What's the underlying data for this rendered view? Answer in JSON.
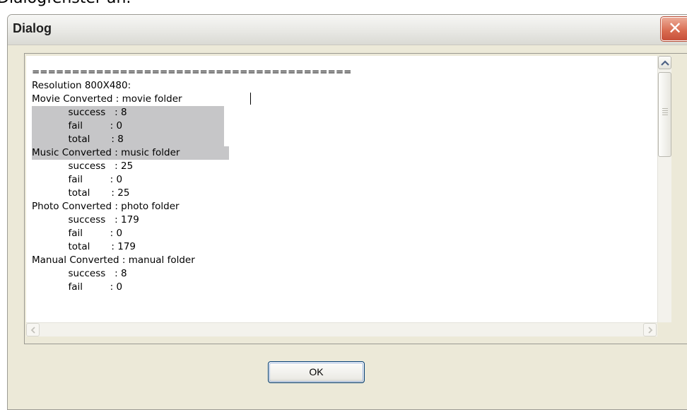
{
  "background": {
    "caption": "Dialogfenster an."
  },
  "window": {
    "title": "Dialog",
    "close_label": "✕"
  },
  "log": {
    "lines": [
      "========================================",
      "Resolution 800X480:",
      "Movie Converted : movie folder",
      "            success   : 8",
      "            fail         : 0",
      "            total       : 8",
      "Music Converted : music folder",
      "            success   : 25",
      "            fail         : 0",
      "            total       : 25",
      "Photo Converted : photo folder",
      "            success   : 179",
      "            fail         : 0",
      "            total       : 179",
      "Manual Converted : manual folder",
      "            success   : 8",
      "            fail         : 0"
    ]
  },
  "buttons": {
    "ok_label": "OK"
  },
  "colors": {
    "dialog_bg": "#ece9d8",
    "selection": "#c6c6c8",
    "close_red": "#d86a4f",
    "ok_border": "#003c74"
  }
}
